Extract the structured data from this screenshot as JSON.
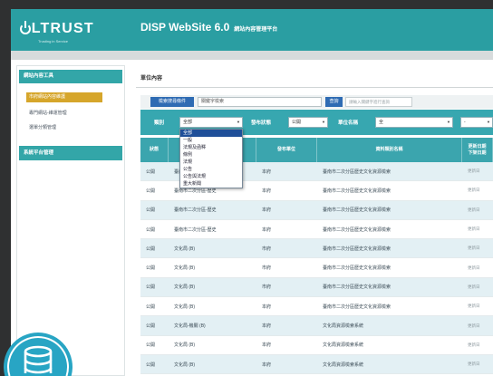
{
  "colors": {
    "header": "#2a9ea2",
    "sideHead": "#33a6a8",
    "active": "#d6a62b",
    "band": "#37a7b0",
    "thead": "#3ba5ae",
    "labelBlue": "#2e6bb3",
    "ddSel": "#1f4f99",
    "rowAlt": "#e3f0f4",
    "badge": "#28a5c4"
  },
  "header": {
    "logo_text": "ULTRUST",
    "logo_icon": "power-u-icon",
    "logo_tagline": "Trusting in Service",
    "title": "DISP WebSite 6.0",
    "subtitle": "網站內容管理平台"
  },
  "sidebar": {
    "sections": [
      {
        "header": "網站內容工具",
        "items": [
          {
            "label": "市府網站內容維護",
            "active": true
          },
          {
            "label": "專門網站-維運管理",
            "active": false
          },
          {
            "label": "選單分類管理",
            "active": false
          }
        ]
      },
      {
        "header": "系統平台管理",
        "items": []
      }
    ]
  },
  "main": {
    "title": "單位內容",
    "search": {
      "label": "檢索搜尋條件",
      "value": "關鍵字檢索",
      "button": "查詢",
      "hint": "請輸入關鍵字進行查詢"
    },
    "filters": {
      "category": {
        "label": "類別",
        "value": "全部",
        "open": true,
        "options": [
          "全部",
          "一般",
          "法規及函釋",
          "條例",
          "法規",
          "公告",
          "公告與法規",
          "重大新聞"
        ]
      },
      "status": {
        "label": "發布狀態",
        "value": "公開"
      },
      "unit": {
        "label": "單位名稱",
        "value": "全"
      },
      "extra": {
        "value": "-"
      }
    },
    "table": {
      "columns": [
        "狀態",
        "標題",
        "發布單位",
        "資料類別名稱",
        "更新日期\n下架日期"
      ],
      "rows": [
        [
          "公開",
          "臺南市二次分區-歷史",
          "本府",
          "臺南市二次分區歷史文化資源檢索",
          "更新日"
        ],
        [
          "公開",
          "臺南市二次分區-歷史",
          "本府",
          "臺南市二次分區歷史文化資源檢索",
          "更新日"
        ],
        [
          "公開",
          "臺南市二次分區-歷史",
          "本府",
          "臺南市二次分區歷史文化資源檢索",
          "更新日"
        ],
        [
          "公開",
          "臺南市二次分區-歷史",
          "本府",
          "臺南市二次分區歷史文化資源檢索",
          "更新日"
        ],
        [
          "公開",
          "文化局 (B)",
          "市府",
          "臺南市二次分區歷史文化資源檢索",
          "更新日"
        ],
        [
          "公開",
          "文化局 (B)",
          "市府",
          "臺南市二次分區歷史文化資源檢索",
          "更新日"
        ],
        [
          "公開",
          "文化局 (B)",
          "市府",
          "臺南市二次分區歷史文化資源檢索",
          "更新日"
        ],
        [
          "公開",
          "文化局 (B)",
          "本府",
          "臺南市二次分區歷史文化資源檢索",
          "更新日"
        ],
        [
          "公開",
          "文化局-機關 (B)",
          "本府",
          "文化局資源檢索系統",
          "更新日"
        ],
        [
          "公開",
          "文化局 (B)",
          "本府",
          "文化局資源檢索系統",
          "更新日"
        ],
        [
          "公開",
          "文化局 (B)",
          "本府",
          "文化局資源檢索系統",
          "更新日"
        ]
      ]
    }
  },
  "badge_icon": "database-icon"
}
